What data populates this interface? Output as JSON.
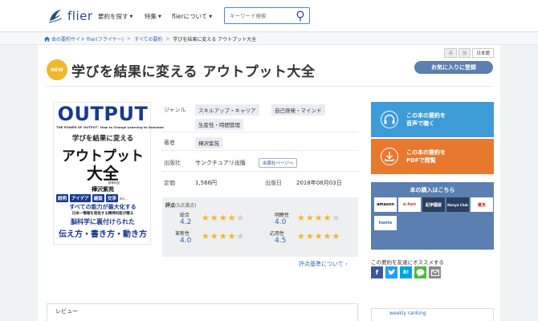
{
  "header": {
    "logo_text": "flier",
    "nav": [
      {
        "label": "要約を探す",
        "icon": "caret-down"
      },
      {
        "label": "特集",
        "icon": "caret-down"
      },
      {
        "label": "flierについて",
        "icon": "caret-down"
      }
    ],
    "search_placeholder": "キーワード検索"
  },
  "breadcrumb": {
    "items": [
      "本の要約サイト flier(フライヤー)",
      "すべての要約"
    ],
    "current": "学びを結果に変える アウトプット大全",
    "separator": ">"
  },
  "lang": [
    "英",
    "独",
    "日本語"
  ],
  "book": {
    "badge": "NEW",
    "title": "学びを結果に変える アウトプット大全",
    "favorite_label": "お気に入りに登録"
  },
  "cover": {
    "output": "OUTPUT",
    "power": "THE POWER OF OUTPUT：How to Change Learning to Outcome",
    "subtitle": "学びを結果に変える",
    "big1": "アウトプット",
    "big2": "大全",
    "author_label": "精神科医",
    "author": "樺沢紫苑",
    "tags": [
      "説明",
      "アイデア",
      "雑談",
      "交渉"
    ],
    "etc": "etc...",
    "line1": "すべての能力が最大化する",
    "line2": "日本一情報を発信する精神科医が贈る",
    "line3": "脳科学に裏付けられた",
    "line4": "伝え方・書き方・動き方"
  },
  "info": {
    "genre_label": "ジャンル",
    "genres": [
      "スキルアップ・キャリア",
      "自己啓発・マインド",
      "生産性・時間管理"
    ],
    "author_label": "著者",
    "author": "樺沢紫苑",
    "publisher_label": "出版社",
    "publisher": "サンクチュアリ出版",
    "publisher_page_label": "出版社ページへ",
    "price_label": "定価",
    "price": "1,566円",
    "date_label": "出版日",
    "date": "2018年08月03日"
  },
  "rating": {
    "heading": "評点",
    "scale": "(5点満点)",
    "items": [
      {
        "name": "総合",
        "score": "4.2",
        "stars": 4.2
      },
      {
        "name": "明瞭性",
        "score": "4.0",
        "stars": 4.0
      },
      {
        "name": "革新性",
        "score": "4.0",
        "stars": 4.0
      },
      {
        "name": "応用性",
        "score": "4.5",
        "stars": 4.5
      }
    ],
    "criteria_link": "評点基準について"
  },
  "actions": {
    "audio_line1": "この本の要約を",
    "audio_line2": "音声で聴く",
    "pdf_line1": "この本の要約を",
    "pdf_line2": "PDFで閲覧"
  },
  "buy": {
    "title": "本の購入はこちら",
    "stores": [
      "amazon",
      "e-hon",
      "紀伊國屋",
      "Honya Club",
      "楽天",
      "honto"
    ]
  },
  "share": {
    "title": "この要約を友達にオススメする",
    "buttons": [
      "facebook",
      "twitter",
      "hatena",
      "line",
      "mail"
    ]
  },
  "bottom": {
    "review_label": "レビュー",
    "weekly_label": "weekly ranking"
  },
  "colors": {
    "brand": "#2b4d78",
    "link": "#2d6bb3",
    "badge": "#f1b72b",
    "audio": "#3d9cd8",
    "pdf": "#e9782f",
    "buy": "#5a7fb0"
  }
}
